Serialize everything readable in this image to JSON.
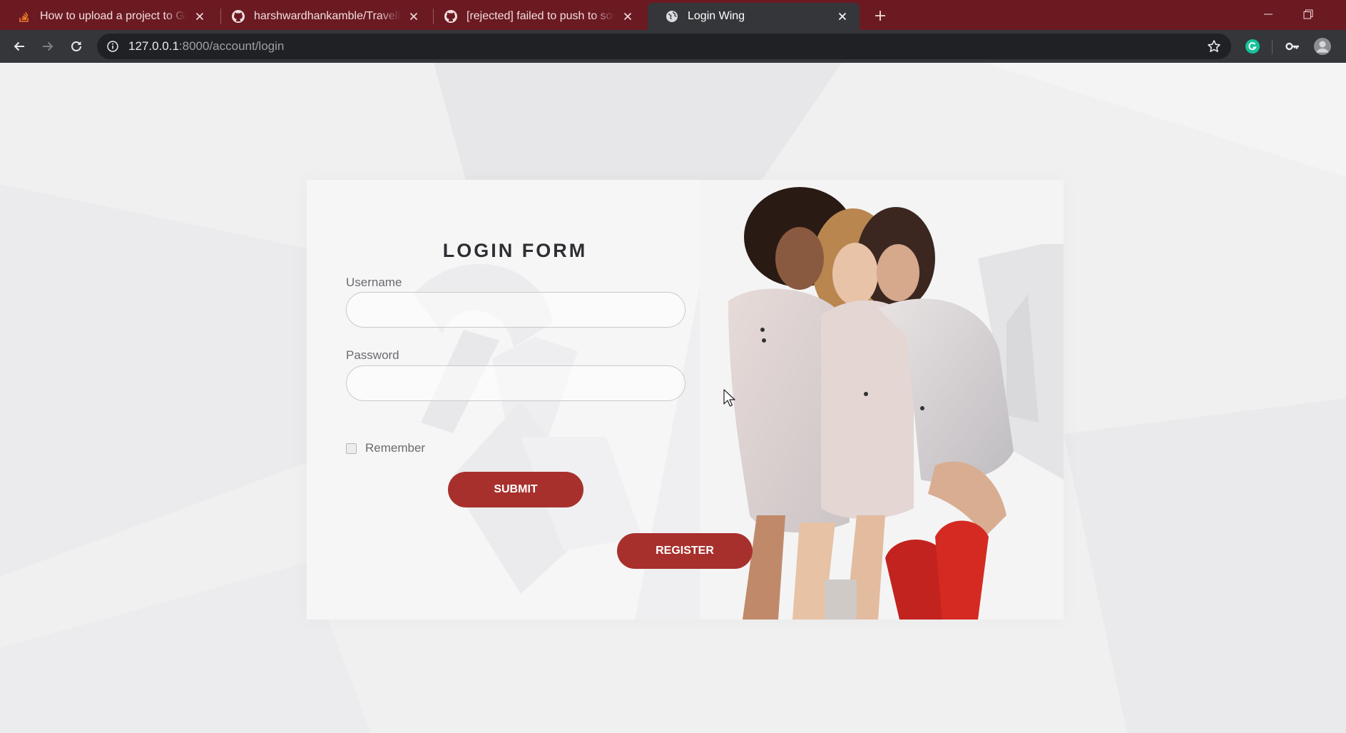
{
  "browser": {
    "tabs": [
      {
        "title": "How to upload a project to Githu",
        "icon": "stackoverflow-icon",
        "active": false
      },
      {
        "title": "harshwardhankamble/Travello: T",
        "icon": "github-icon",
        "active": false
      },
      {
        "title": "[rejected] failed to push to some",
        "icon": "github-icon",
        "active": false
      },
      {
        "title": "Login Wing",
        "icon": "globe-icon",
        "active": true
      }
    ],
    "url_host": "127.0.0.1",
    "url_rest": ":8000/account/login",
    "colors": {
      "tabbar": "#6b1a22",
      "toolbar": "#35363a",
      "omnibox": "#202124"
    }
  },
  "login": {
    "title": "LOGIN FORM",
    "username_label": "Username",
    "username_value": "",
    "password_label": "Password",
    "password_value": "",
    "remember_label": "Remember",
    "remember_checked": false,
    "submit_label": "SUBMIT",
    "register_label": "REGISTER",
    "accent_color": "#a8302c"
  }
}
